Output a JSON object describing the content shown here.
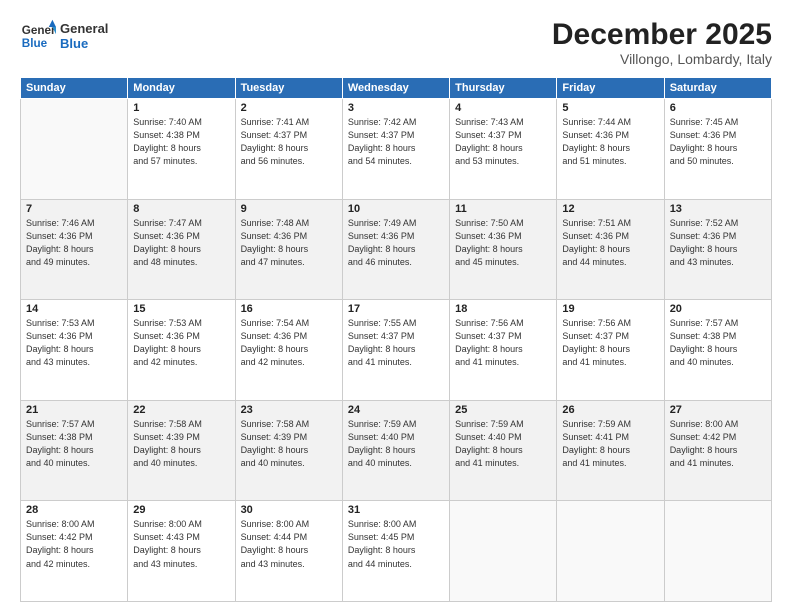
{
  "logo": {
    "line1": "General",
    "line2": "Blue"
  },
  "title": "December 2025",
  "location": "Villongo, Lombardy, Italy",
  "days_header": [
    "Sunday",
    "Monday",
    "Tuesday",
    "Wednesday",
    "Thursday",
    "Friday",
    "Saturday"
  ],
  "weeks": [
    [
      {
        "num": "",
        "info": ""
      },
      {
        "num": "1",
        "info": "Sunrise: 7:40 AM\nSunset: 4:38 PM\nDaylight: 8 hours\nand 57 minutes."
      },
      {
        "num": "2",
        "info": "Sunrise: 7:41 AM\nSunset: 4:37 PM\nDaylight: 8 hours\nand 56 minutes."
      },
      {
        "num": "3",
        "info": "Sunrise: 7:42 AM\nSunset: 4:37 PM\nDaylight: 8 hours\nand 54 minutes."
      },
      {
        "num": "4",
        "info": "Sunrise: 7:43 AM\nSunset: 4:37 PM\nDaylight: 8 hours\nand 53 minutes."
      },
      {
        "num": "5",
        "info": "Sunrise: 7:44 AM\nSunset: 4:36 PM\nDaylight: 8 hours\nand 51 minutes."
      },
      {
        "num": "6",
        "info": "Sunrise: 7:45 AM\nSunset: 4:36 PM\nDaylight: 8 hours\nand 50 minutes."
      }
    ],
    [
      {
        "num": "7",
        "info": "Sunrise: 7:46 AM\nSunset: 4:36 PM\nDaylight: 8 hours\nand 49 minutes."
      },
      {
        "num": "8",
        "info": "Sunrise: 7:47 AM\nSunset: 4:36 PM\nDaylight: 8 hours\nand 48 minutes."
      },
      {
        "num": "9",
        "info": "Sunrise: 7:48 AM\nSunset: 4:36 PM\nDaylight: 8 hours\nand 47 minutes."
      },
      {
        "num": "10",
        "info": "Sunrise: 7:49 AM\nSunset: 4:36 PM\nDaylight: 8 hours\nand 46 minutes."
      },
      {
        "num": "11",
        "info": "Sunrise: 7:50 AM\nSunset: 4:36 PM\nDaylight: 8 hours\nand 45 minutes."
      },
      {
        "num": "12",
        "info": "Sunrise: 7:51 AM\nSunset: 4:36 PM\nDaylight: 8 hours\nand 44 minutes."
      },
      {
        "num": "13",
        "info": "Sunrise: 7:52 AM\nSunset: 4:36 PM\nDaylight: 8 hours\nand 43 minutes."
      }
    ],
    [
      {
        "num": "14",
        "info": "Sunrise: 7:53 AM\nSunset: 4:36 PM\nDaylight: 8 hours\nand 43 minutes."
      },
      {
        "num": "15",
        "info": "Sunrise: 7:53 AM\nSunset: 4:36 PM\nDaylight: 8 hours\nand 42 minutes."
      },
      {
        "num": "16",
        "info": "Sunrise: 7:54 AM\nSunset: 4:36 PM\nDaylight: 8 hours\nand 42 minutes."
      },
      {
        "num": "17",
        "info": "Sunrise: 7:55 AM\nSunset: 4:37 PM\nDaylight: 8 hours\nand 41 minutes."
      },
      {
        "num": "18",
        "info": "Sunrise: 7:56 AM\nSunset: 4:37 PM\nDaylight: 8 hours\nand 41 minutes."
      },
      {
        "num": "19",
        "info": "Sunrise: 7:56 AM\nSunset: 4:37 PM\nDaylight: 8 hours\nand 41 minutes."
      },
      {
        "num": "20",
        "info": "Sunrise: 7:57 AM\nSunset: 4:38 PM\nDaylight: 8 hours\nand 40 minutes."
      }
    ],
    [
      {
        "num": "21",
        "info": "Sunrise: 7:57 AM\nSunset: 4:38 PM\nDaylight: 8 hours\nand 40 minutes."
      },
      {
        "num": "22",
        "info": "Sunrise: 7:58 AM\nSunset: 4:39 PM\nDaylight: 8 hours\nand 40 minutes."
      },
      {
        "num": "23",
        "info": "Sunrise: 7:58 AM\nSunset: 4:39 PM\nDaylight: 8 hours\nand 40 minutes."
      },
      {
        "num": "24",
        "info": "Sunrise: 7:59 AM\nSunset: 4:40 PM\nDaylight: 8 hours\nand 40 minutes."
      },
      {
        "num": "25",
        "info": "Sunrise: 7:59 AM\nSunset: 4:40 PM\nDaylight: 8 hours\nand 41 minutes."
      },
      {
        "num": "26",
        "info": "Sunrise: 7:59 AM\nSunset: 4:41 PM\nDaylight: 8 hours\nand 41 minutes."
      },
      {
        "num": "27",
        "info": "Sunrise: 8:00 AM\nSunset: 4:42 PM\nDaylight: 8 hours\nand 41 minutes."
      }
    ],
    [
      {
        "num": "28",
        "info": "Sunrise: 8:00 AM\nSunset: 4:42 PM\nDaylight: 8 hours\nand 42 minutes."
      },
      {
        "num": "29",
        "info": "Sunrise: 8:00 AM\nSunset: 4:43 PM\nDaylight: 8 hours\nand 43 minutes."
      },
      {
        "num": "30",
        "info": "Sunrise: 8:00 AM\nSunset: 4:44 PM\nDaylight: 8 hours\nand 43 minutes."
      },
      {
        "num": "31",
        "info": "Sunrise: 8:00 AM\nSunset: 4:45 PM\nDaylight: 8 hours\nand 44 minutes."
      },
      {
        "num": "",
        "info": ""
      },
      {
        "num": "",
        "info": ""
      },
      {
        "num": "",
        "info": ""
      }
    ]
  ]
}
